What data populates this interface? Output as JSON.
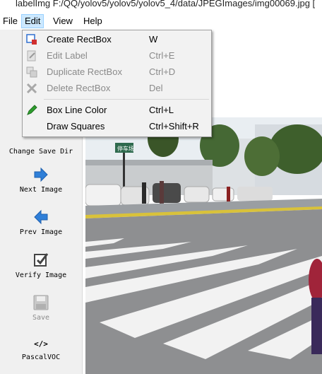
{
  "window": {
    "title": "labelImg F:/QQ/yolov5/yolov5/yolov5_4/data/JPEGImages/img00069.jpg ["
  },
  "menubar": {
    "file": "File",
    "edit": "Edit",
    "view": "View",
    "help": "Help"
  },
  "edit_menu": {
    "items": [
      {
        "label": "Create RectBox",
        "shortcut": "W",
        "enabled": true,
        "icon": "create-rectbox-icon"
      },
      {
        "label": "Edit Label",
        "shortcut": "Ctrl+E",
        "enabled": false,
        "icon": "edit-label-icon"
      },
      {
        "label": "Duplicate RectBox",
        "shortcut": "Ctrl+D",
        "enabled": false,
        "icon": "duplicate-icon"
      },
      {
        "label": "Delete RectBox",
        "shortcut": "Del",
        "enabled": false,
        "icon": "delete-icon"
      },
      {
        "label": "Box Line Color",
        "shortcut": "Ctrl+L",
        "enabled": true,
        "icon": "pencil-icon"
      },
      {
        "label": "Draw Squares",
        "shortcut": "Ctrl+Shift+R",
        "enabled": true,
        "icon": ""
      }
    ]
  },
  "toolbar": {
    "change_save_dir": "Change Save Dir",
    "next_image": "Next Image",
    "prev_image": "Prev Image",
    "verify_image": "Verify Image",
    "save": "Save",
    "pascal_voc": "PascalVOC",
    "format_glyph": "</>"
  },
  "photo": {
    "sign_text": "停车场"
  },
  "colors": {
    "accent_blue": "#2f7fd8",
    "menu_highlight": "#cce8ff",
    "pencil_green": "#2e9e2e"
  }
}
